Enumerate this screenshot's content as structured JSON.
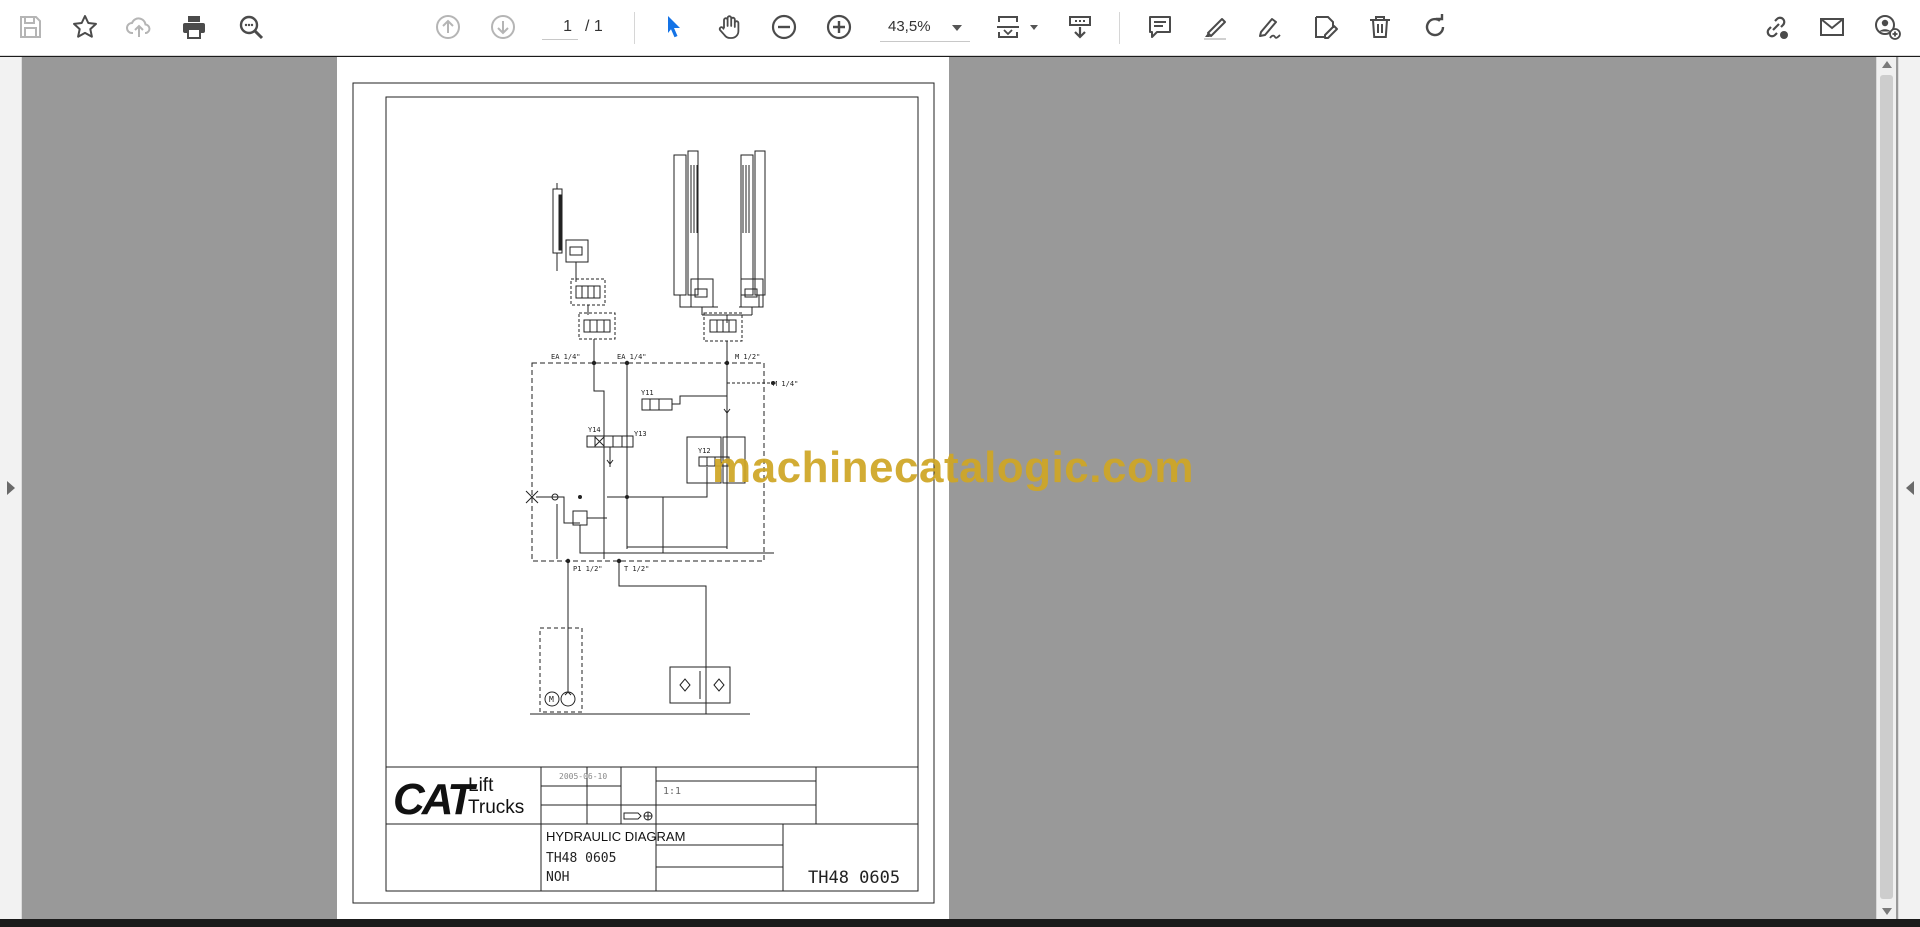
{
  "toolbar": {
    "page_current": "1",
    "page_total": "/ 1",
    "zoom": "43,5%"
  },
  "drawing": {
    "port_labels": {
      "ea1": "EA 1/4\"",
      "ea2": "EA 1/4\"",
      "m12": "M 1/2\"",
      "m14": "M 1/4\"",
      "p1": "P1 1/2\"",
      "t": "T 1/2\""
    },
    "valve_labels": {
      "y11": "Y11",
      "y14": "Y14",
      "y13": "Y13",
      "y12": "Y12"
    },
    "motor_label": "M",
    "title_block": {
      "brand": "CAT",
      "brand_sub1": "Lift",
      "brand_sub2": "Trucks",
      "date": "2005-06-10",
      "scale": "1:1",
      "title": "HYDRAULIC DIAGRAM",
      "model": "TH48 0605",
      "code": "NOH",
      "drawing_no": "TH48 0605"
    }
  },
  "watermark": "machinecatalogic.com",
  "colors": {
    "viewer_bg": "#999999",
    "toolbar_bg": "#ffffff",
    "accent_blue": "#1473e6",
    "watermark": "#cfa625"
  }
}
